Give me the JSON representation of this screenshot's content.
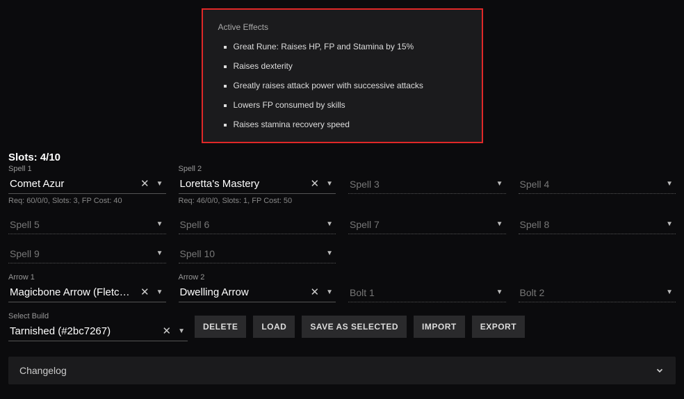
{
  "effects": {
    "title": "Active Effects",
    "items": [
      "Great Rune: Raises HP, FP and Stamina by 15%",
      "Raises dexterity",
      "Greatly raises attack power with successive attacks",
      "Lowers FP consumed by skills",
      "Raises stamina recovery speed"
    ]
  },
  "slots_title": "Slots: 4/10",
  "spells": [
    {
      "label": "Spell 1",
      "value": "Comet Azur",
      "req": "Req: 60/0/0, Slots: 3, FP Cost: 40",
      "filled": true
    },
    {
      "label": "Spell 2",
      "value": "Loretta's Mastery",
      "req": "Req: 46/0/0, Slots: 1, FP Cost: 50",
      "filled": true
    },
    {
      "label": "Spell 3",
      "value": "Spell 3",
      "filled": false
    },
    {
      "label": "Spell 4",
      "value": "Spell 4",
      "filled": false
    },
    {
      "label": "Spell 5",
      "value": "Spell 5",
      "filled": false
    },
    {
      "label": "Spell 6",
      "value": "Spell 6",
      "filled": false
    },
    {
      "label": "Spell 7",
      "value": "Spell 7",
      "filled": false
    },
    {
      "label": "Spell 8",
      "value": "Spell 8",
      "filled": false
    },
    {
      "label": "Spell 9",
      "value": "Spell 9",
      "filled": false
    },
    {
      "label": "Spell 10",
      "value": "Spell 10",
      "filled": false
    }
  ],
  "arrows": [
    {
      "label": "Arrow 1",
      "value": "Magicbone Arrow (Fletched)",
      "filled": true
    },
    {
      "label": "Arrow 2",
      "value": "Dwelling Arrow",
      "filled": true
    },
    {
      "label": "Bolt 1",
      "value": "Bolt 1",
      "filled": false,
      "nolabel": true
    },
    {
      "label": "Bolt 2",
      "value": "Bolt 2",
      "filled": false,
      "nolabel": true
    }
  ],
  "build": {
    "label": "Select Build",
    "value": "Tarnished (#2bc7267)"
  },
  "buttons": {
    "delete": "DELETE",
    "load": "LOAD",
    "save": "SAVE AS SELECTED",
    "import": "IMPORT",
    "export": "EXPORT"
  },
  "changelog": "Changelog"
}
